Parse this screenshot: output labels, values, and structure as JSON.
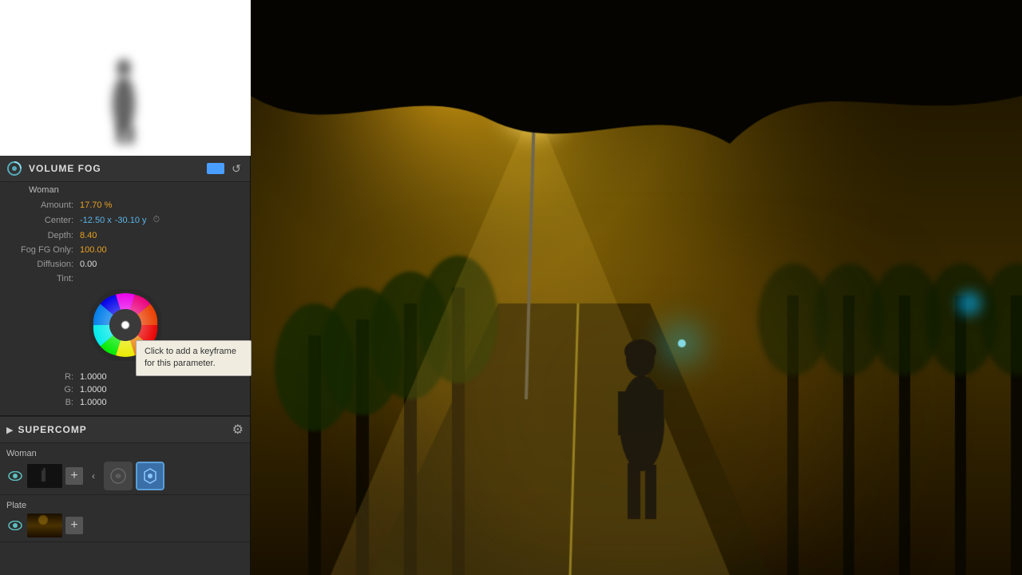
{
  "preview": {
    "bg": "white"
  },
  "volume_fog": {
    "title": "VOLUME FOG",
    "layer_name": "Woman",
    "amount_label": "Amount:",
    "amount_value": "17.70 %",
    "center_label": "Center:",
    "center_x": "-12.50 x",
    "center_y": "-30.10 y",
    "depth_label": "Depth:",
    "depth_value": "8.40",
    "fog_fg_label": "Fog FG Only:",
    "fog_fg_value": "100.00",
    "diffusion_label": "Diffusion:",
    "diffusion_value": "0.00",
    "tint_label": "Tint:",
    "r_label": "R:",
    "r_value": "1.0000",
    "g_label": "G:",
    "g_value": "1.0000",
    "b_label": "B:",
    "b_value": "1.0000"
  },
  "tooltip": {
    "text": "Click to add a keyframe for this parameter."
  },
  "supercomp": {
    "title": "SUPERCOMP",
    "layer1_name": "Woman",
    "layer2_name": "Plate",
    "settings_icon": "≡"
  }
}
